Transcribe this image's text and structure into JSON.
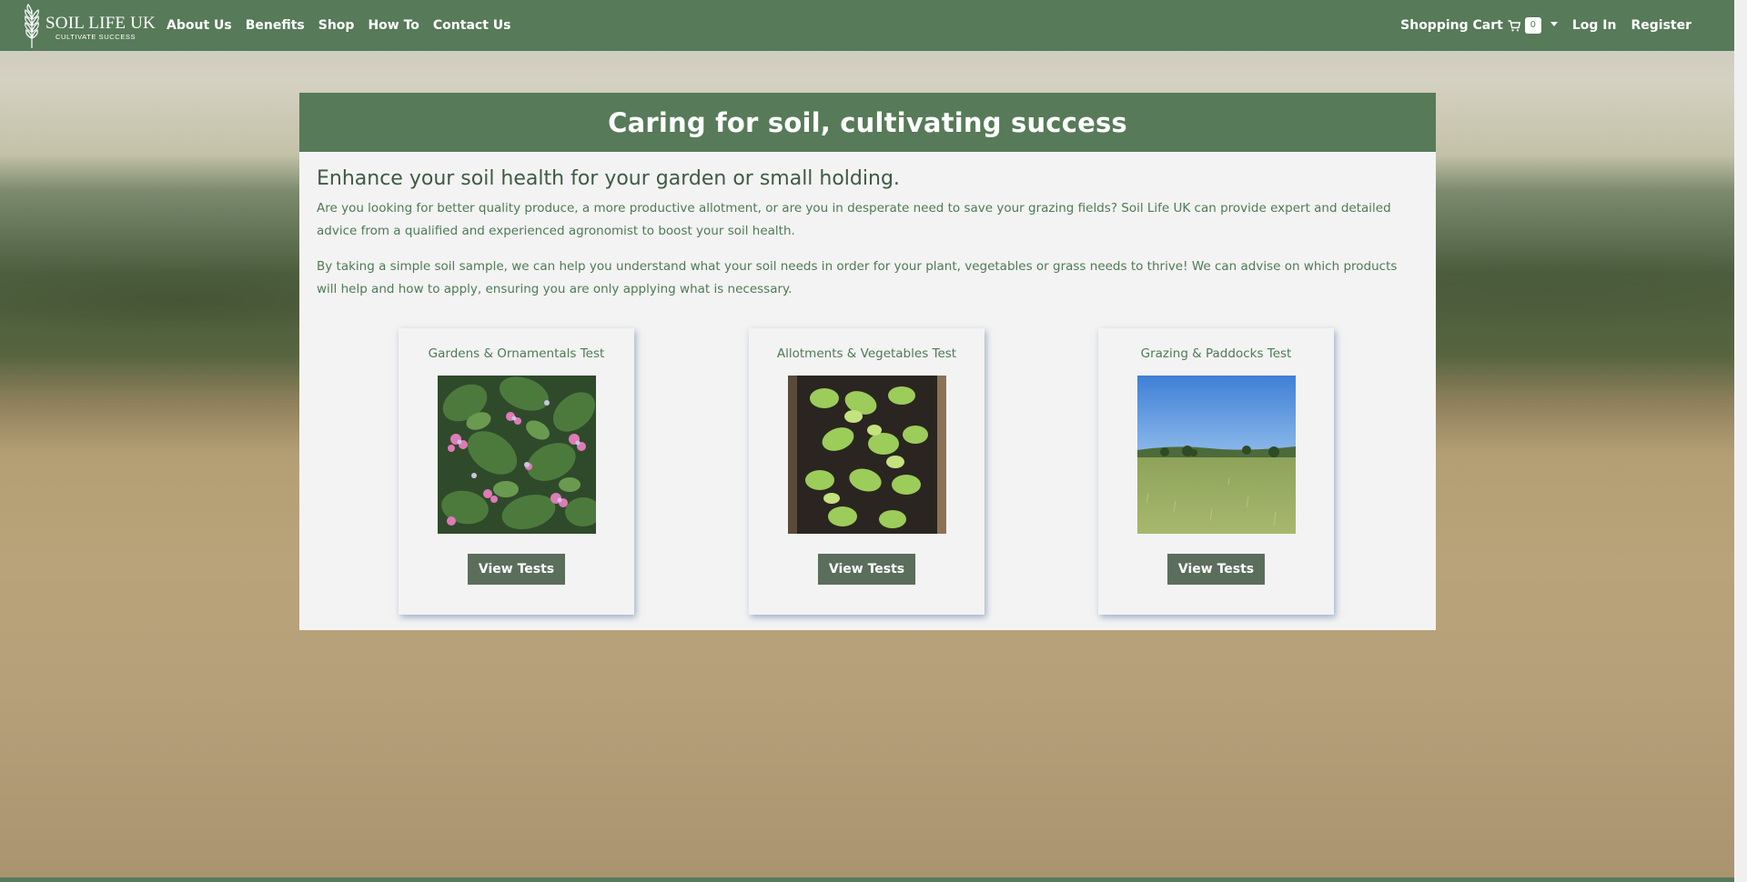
{
  "brand": {
    "title": "SOIL LIFE UK",
    "tagline": "CULTIVATE SUCCESS"
  },
  "nav": {
    "links": [
      "About Us",
      "Benefits",
      "Shop",
      "How To",
      "Contact Us"
    ],
    "cart_label": "Shopping Cart",
    "cart_count": "0",
    "login": "Log In",
    "register": "Register"
  },
  "hero": {
    "title": "Caring for soil, cultivating success",
    "heading": "Enhance your soil health for your garden or small holding.",
    "paragraph1": "Are you looking for better quality produce, a more productive allotment, or are you in desperate need to save your grazing fields? Soil Life UK can provide expert and detailed advice from a qualified and experienced agronomist to boost your soil health.",
    "paragraph2": "By taking a simple soil sample, we can help you understand what your soil needs in order for your plant, vegetables or grass needs to thrive! We can advise on which products will help and how to apply, ensuring you are only applying what is necessary."
  },
  "cards": [
    {
      "title": "Gardens & Ornamentals Test",
      "button": "View Tests"
    },
    {
      "title": "Allotments & Vegetables Test",
      "button": "View Tests"
    },
    {
      "title": "Grazing & Paddocks Test",
      "button": "View Tests"
    }
  ],
  "colors": {
    "brand_green": "#577a59",
    "text_green": "#4f7a55",
    "button": "#5b6e5c",
    "panel_bg": "#f3f3f3"
  }
}
